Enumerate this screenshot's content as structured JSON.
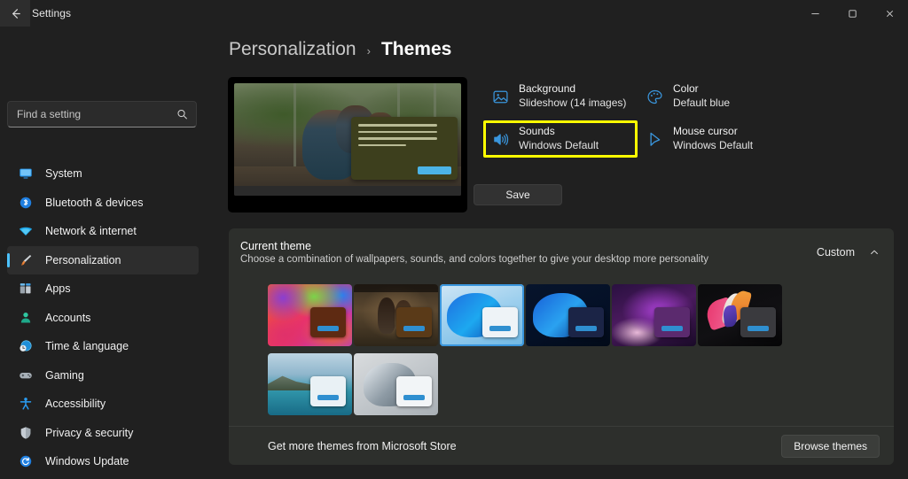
{
  "window": {
    "title": "Settings",
    "back_icon": "back-arrow-icon",
    "minimize_label": "─",
    "maximize_label": "❐",
    "close_label": "✕"
  },
  "search": {
    "placeholder": "Find a setting",
    "value": "",
    "icon": "search-icon"
  },
  "sidebar": {
    "items": [
      {
        "label": "System",
        "icon": "monitor-icon",
        "active": false
      },
      {
        "label": "Bluetooth & devices",
        "icon": "bluetooth-icon",
        "active": false
      },
      {
        "label": "Network & internet",
        "icon": "wifi-icon",
        "active": false
      },
      {
        "label": "Personalization",
        "icon": "paintbrush-icon",
        "active": true
      },
      {
        "label": "Apps",
        "icon": "apps-grid-icon",
        "active": false
      },
      {
        "label": "Accounts",
        "icon": "person-icon",
        "active": false
      },
      {
        "label": "Time & language",
        "icon": "clock-globe-icon",
        "active": false
      },
      {
        "label": "Gaming",
        "icon": "gamepad-icon",
        "active": false
      },
      {
        "label": "Accessibility",
        "icon": "accessibility-person-icon",
        "active": false
      },
      {
        "label": "Privacy & security",
        "icon": "shield-icon",
        "active": false
      },
      {
        "label": "Windows Update",
        "icon": "update-refresh-icon",
        "active": false
      }
    ]
  },
  "breadcrumb": {
    "parent": "Personalization",
    "separator": "›",
    "current": "Themes"
  },
  "theme_options": [
    {
      "title": "Background",
      "subtitle": "Slideshow (14 images)",
      "icon": "picture-icon",
      "highlighted": false
    },
    {
      "title": "Color",
      "subtitle": "Default blue",
      "icon": "palette-icon",
      "highlighted": false
    },
    {
      "title": "Sounds",
      "subtitle": "Windows Default",
      "icon": "speaker-sound-icon",
      "highlighted": true
    },
    {
      "title": "Mouse cursor",
      "subtitle": "Windows Default",
      "icon": "cursor-arrow-icon",
      "highlighted": false
    }
  ],
  "save_button": {
    "label": "Save"
  },
  "current_theme": {
    "title": "Current theme",
    "subtitle": "Choose a combination of wallpapers, sounds, and colors together to give your desktop more personality",
    "value": "Custom",
    "chevron_icon": "chevron-up-icon",
    "thumbnails": [
      {
        "name": "colorful-umbrellas-theme",
        "selected": false
      },
      {
        "name": "movie-poster-theme",
        "selected": false
      },
      {
        "name": "windows-bloom-light-theme",
        "selected": true
      },
      {
        "name": "windows-bloom-dark-theme",
        "selected": false
      },
      {
        "name": "purple-glow-theme",
        "selected": false
      },
      {
        "name": "dark-flower-theme",
        "selected": false
      },
      {
        "name": "coastal-landscape-theme",
        "selected": false
      },
      {
        "name": "grey-bloom-theme",
        "selected": false
      }
    ]
  },
  "store_row": {
    "label": "Get more themes from Microsoft Store",
    "button_label": "Browse themes"
  },
  "colors": {
    "page_background": "#202020",
    "card_background": "#2d2f2c",
    "accent_blue": "#4cc2ff",
    "icon_blue": "#3a96dd",
    "highlight_yellow": "#ffff00"
  }
}
